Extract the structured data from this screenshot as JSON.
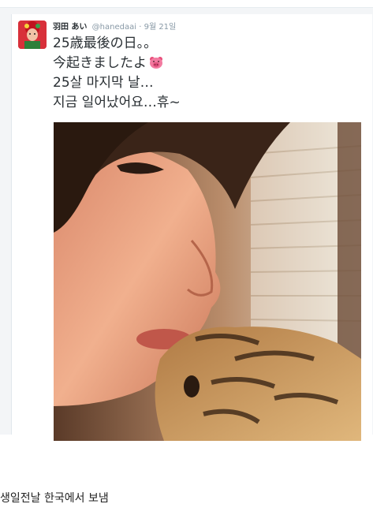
{
  "tweet": {
    "display_name": "羽田 あい",
    "handle": "@hanedaai",
    "separator": "·",
    "date": "9월 21일",
    "lines": [
      "25歳最後の日。。",
      "今起きましたよ",
      "25살 마지막 날…",
      "지금 일어났어요…휴~"
    ],
    "emoji_icon": "pig-face-icon"
  },
  "caption": "생일전날 한국에서 보냄"
}
